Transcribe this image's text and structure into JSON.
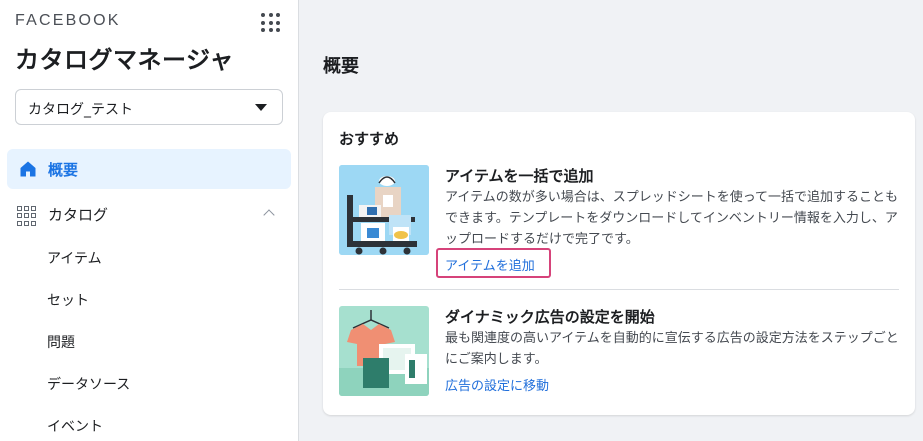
{
  "sidebar": {
    "brand": "FACEBOOK",
    "app_title": "カタログマネージャ",
    "catalog_select": {
      "value": "カタログ_テスト"
    },
    "nav": {
      "overview": "概要",
      "catalog": "カタログ",
      "sub_items": [
        "アイテム",
        "セット",
        "問題",
        "データソース",
        "イベント"
      ]
    }
  },
  "main": {
    "page_title": "概要",
    "card": {
      "title": "おすすめ",
      "recommendations": [
        {
          "title": "アイテムを一括で追加",
          "description": "アイテムの数が多い場合は、スプレッドシートを使って一括で追加することもできます。テンプレートをダウンロードしてインベントリー情報を入力し、アップロードするだけで完了です。",
          "link": "アイテムを追加"
        },
        {
          "title": "ダイナミック広告の設定を開始",
          "description": "最も関連度の高いアイテムを自動的に宣伝する広告の設定方法をステップごとにご案内します。",
          "link": "広告の設定に移動"
        }
      ]
    }
  },
  "colors": {
    "accent": "#1b74e4",
    "link": "#216fdb",
    "highlight_border": "#d6437a",
    "active_nav_bg": "#e7f3ff"
  }
}
